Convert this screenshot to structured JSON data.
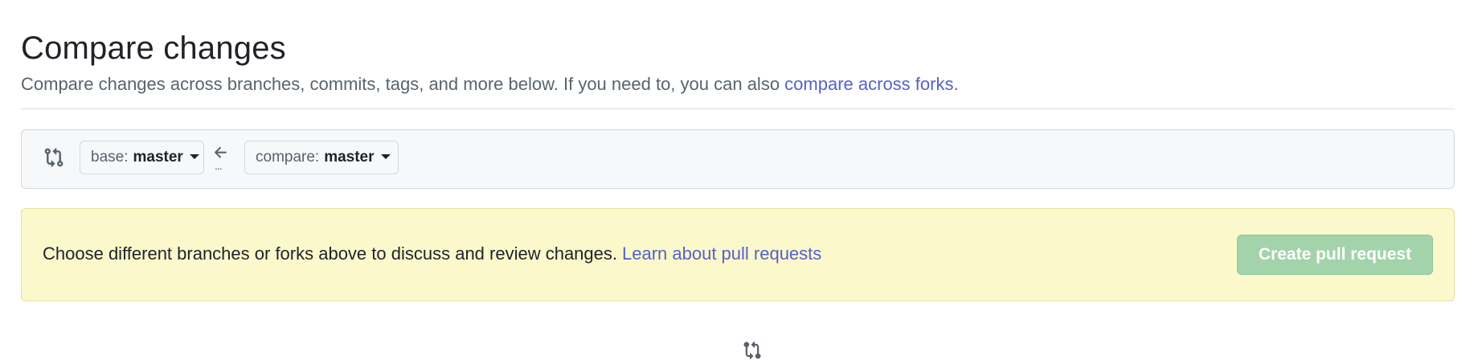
{
  "header": {
    "title": "Compare changes",
    "subtitle_text": "Compare changes across branches, commits, tags, and more below. If you need to, you can also ",
    "subtitle_link": "compare across forks",
    "subtitle_end": "."
  },
  "range": {
    "compare_icon": "git-compare-icon",
    "base_prefix": "base:",
    "base_branch": "master",
    "arrow_icon": "arrow-left-icon",
    "dots": "...",
    "compare_prefix": "compare:",
    "compare_branch": "master"
  },
  "notice": {
    "text": "Choose different branches or forks above to discuss and review changes.",
    "link": "Learn about pull requests",
    "button": "Create pull request"
  },
  "colors": {
    "link": "#5561c9",
    "notice_bg": "#fbf8cb",
    "button_disabled": "#a3d3aa"
  }
}
